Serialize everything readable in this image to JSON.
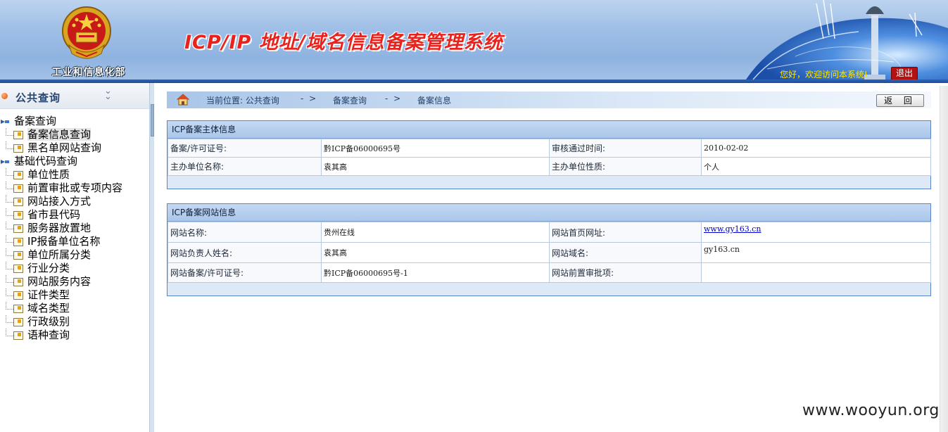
{
  "header": {
    "ministry_name": "工业和信息化部",
    "system_title": "ICP/IP 地址/域名信息备案管理系统",
    "greeting": "您好，欢迎访问本系统!",
    "logout_label": "退出"
  },
  "sidebar": {
    "title": "公共查询",
    "groups": [
      {
        "label": "备案查询",
        "items": [
          "备案信息查询",
          "黑名单网站查询"
        ]
      },
      {
        "label": "基础代码查询",
        "items": [
          "单位性质",
          "前置审批或专项内容",
          "网站接入方式",
          "省市县代码",
          "服务器放置地",
          "IP报备单位名称",
          "单位所属分类",
          "行业分类",
          "网站服务内容",
          "证件类型",
          "域名类型",
          "行政级别",
          "语种查询"
        ]
      }
    ],
    "selected": "备案信息查询"
  },
  "breadcrumb": {
    "current_location": "当前位置: 公共查询",
    "sep1": "- >",
    "level2": "备案查询",
    "sep2": "- >",
    "level3": "备案信息"
  },
  "back_button": "返 回",
  "subject_panel": {
    "title": "ICP备案主体信息",
    "rows": [
      [
        "备案/许可证号:",
        "黔ICP备06000695号",
        "审核通过时间:",
        "2010-02-02"
      ],
      [
        "主办单位名称:",
        "袁其高",
        "主办单位性质:",
        "个人"
      ]
    ]
  },
  "website_panel": {
    "title": "ICP备案网站信息",
    "rows": [
      [
        "网站名称:",
        "贵州在线",
        "网站首页网址:",
        "www.gy163.cn"
      ],
      [
        "网站负责人姓名:",
        "袁其高",
        "网站域名:",
        "gy163.cn"
      ],
      [
        "网站备案/许可证号:",
        "黔ICP备06000695号-1",
        "网站前置审批项:",
        ""
      ]
    ]
  },
  "watermark": "www.wooyun.org",
  "colors": {
    "title_red": "#e8231d",
    "header_blue": "#8fb3e0",
    "greeting_yellow": "#ffe600",
    "panel_border": "#5a86c3"
  }
}
